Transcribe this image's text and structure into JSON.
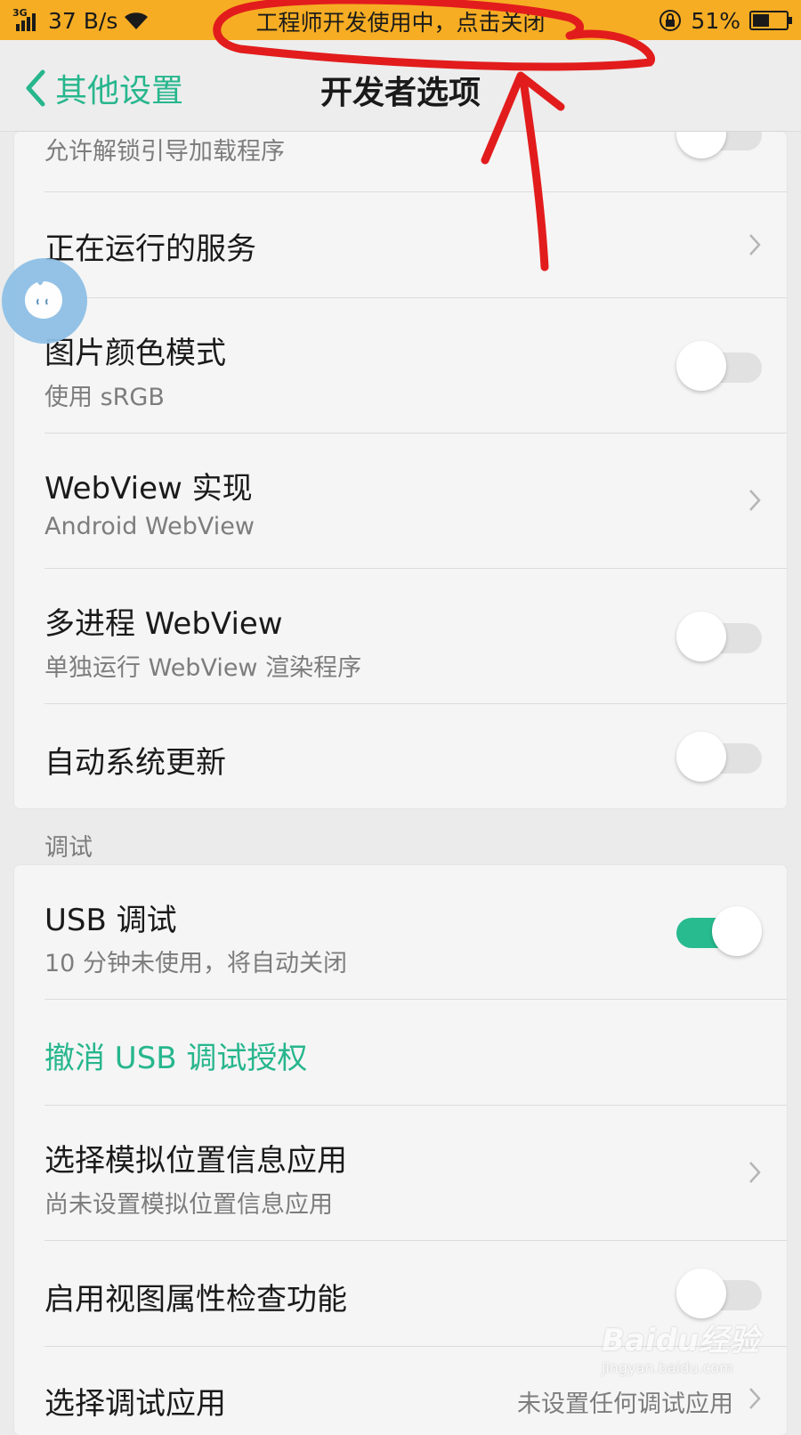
{
  "status_bar": {
    "network": "3G",
    "speed": "37 B/s",
    "notice": "工程师开发使用中，点击关闭",
    "battery_percent": "51%",
    "battery_level": 0.51
  },
  "header": {
    "back_label": "其他设置",
    "title": "开发者选项"
  },
  "card1": {
    "rows": [
      {
        "subtitle": "允许解锁引导加载程序",
        "toggle": false
      },
      {
        "title": "正在运行的服务"
      },
      {
        "title": "图片颜色模式",
        "subtitle": "使用 sRGB",
        "toggle": false
      },
      {
        "title": "WebView 实现",
        "subtitle": "Android WebView"
      },
      {
        "title": "多进程 WebView",
        "subtitle": "单独运行 WebView 渲染程序",
        "toggle": false
      },
      {
        "title": "自动系统更新",
        "toggle": false
      }
    ]
  },
  "section_debug": "调试",
  "card2": {
    "rows": [
      {
        "title": "USB 调试",
        "subtitle": "10 分钟未使用，将自动关闭",
        "toggle": true
      },
      {
        "title": "撤消 USB 调试授权"
      },
      {
        "title": "选择模拟位置信息应用",
        "subtitle": "尚未设置模拟位置信息应用"
      },
      {
        "title": "启用视图属性检查功能",
        "toggle": false
      },
      {
        "title": "选择调试应用",
        "value": "未设置任何调试应用"
      }
    ]
  },
  "watermark": {
    "brand": "Baidu经验",
    "url": "jingyan.baidu.com"
  },
  "colors": {
    "status_bar_bg": "#f6ad24",
    "accent_green": "#27b68d",
    "annotation_red": "#e21c1c"
  }
}
